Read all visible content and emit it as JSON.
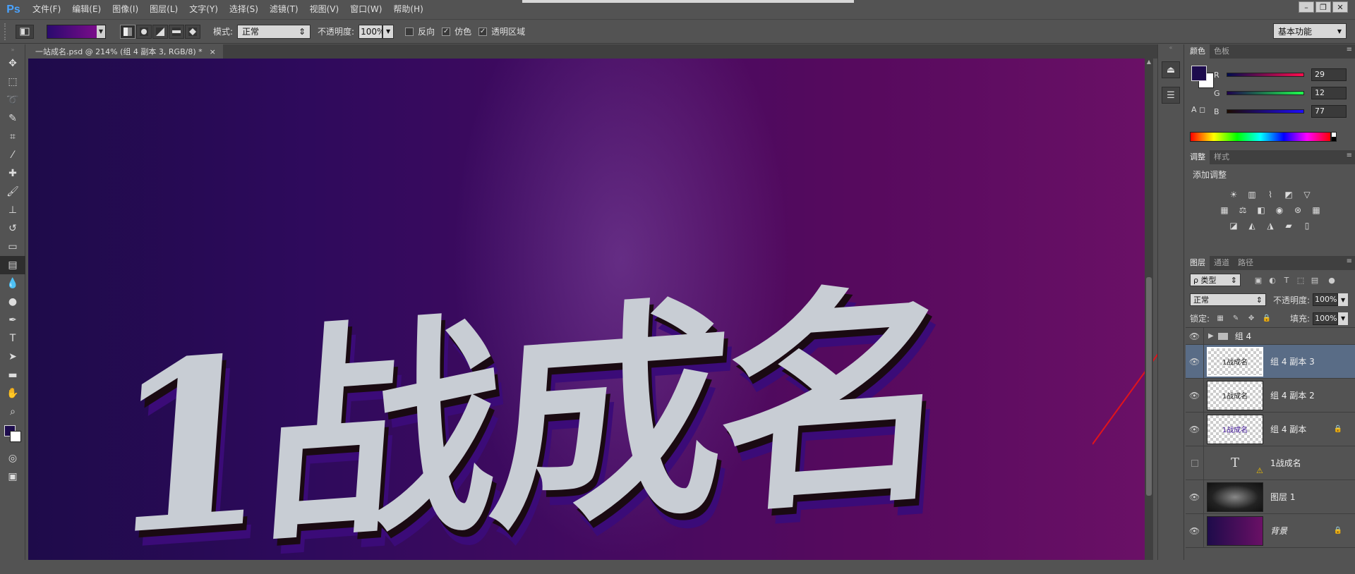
{
  "app": {
    "logo": "Ps",
    "menus": [
      "文件(F)",
      "编辑(E)",
      "图像(I)",
      "图层(L)",
      "文字(Y)",
      "选择(S)",
      "滤镜(T)",
      "视图(V)",
      "窗口(W)",
      "帮助(H)"
    ],
    "window_controls": [
      "–",
      "❐",
      "✕"
    ]
  },
  "options": {
    "mode_label": "模式:",
    "mode_value": "正常",
    "opacity_label": "不透明度:",
    "opacity_value": "100%",
    "reverse_label": "反向",
    "reverse_checked": false,
    "dither_label": "仿色",
    "dither_checked": true,
    "transparency_label": "透明区域",
    "transparency_checked": true,
    "gradient_colors": [
      "#2a0a6e",
      "#7a0c8a"
    ],
    "workspace": "基本功能"
  },
  "document": {
    "tab_label": "一站成名.psd @ 214% (组 4 副本 3, RGB/8) *",
    "tab_close": "×",
    "artwork_text": "1战成名"
  },
  "color_panel": {
    "tabs": [
      "颜色",
      "色板"
    ],
    "fg_color": "#1d0c4d",
    "bg_color": "#ffffff",
    "r_label": "R",
    "r_value": "29",
    "g_label": "G",
    "g_value": "12",
    "b_label": "B",
    "b_value": "77"
  },
  "adjust_panel": {
    "tabs": [
      "调整",
      "样式"
    ],
    "title": "添加调整"
  },
  "layers_panel": {
    "tabs": [
      "图层",
      "通道",
      "路径"
    ],
    "kind_label": "ρ 类型",
    "blend_mode": "正常",
    "opacity_label": "不透明度:",
    "opacity_value": "100%",
    "lock_label": "锁定:",
    "fill_label": "填充:",
    "fill_value": "100%",
    "layers": [
      {
        "name": "组 4",
        "type": "group",
        "visible": true
      },
      {
        "name": "组 4 副本 3",
        "type": "pixel",
        "visible": true,
        "selected": true,
        "thumb": "1战成名"
      },
      {
        "name": "组 4 副本 2",
        "type": "pixel",
        "visible": true,
        "thumb": "1战成名"
      },
      {
        "name": "组 4 副本",
        "type": "pixel",
        "visible": true,
        "locked": true,
        "thumb": "1战成名"
      },
      {
        "name": "1战成名",
        "type": "text",
        "visible": false,
        "warning": true
      },
      {
        "name": "图层 1",
        "type": "pixel",
        "visible": true,
        "thumb_style": "dark"
      },
      {
        "name": "背景",
        "type": "background",
        "visible": true,
        "locked": true,
        "thumb_style": "purple"
      }
    ]
  }
}
